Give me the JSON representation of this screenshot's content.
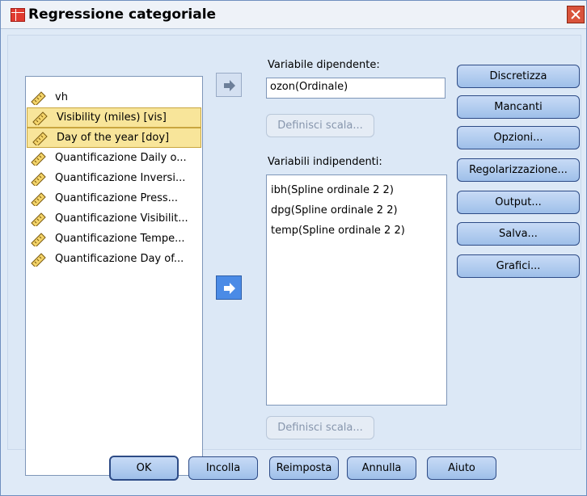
{
  "window": {
    "title": "Regressione categoriale"
  },
  "source_list": [
    {
      "label": "vh",
      "selected": false
    },
    {
      "label": "Visibility (miles) [vis]",
      "selected": true
    },
    {
      "label": "Day of the year [doy]",
      "selected": true
    },
    {
      "label": "Quantificazione Daily o...",
      "selected": false
    },
    {
      "label": "Quantificazione Inversi...",
      "selected": false
    },
    {
      "label": "Quantificazione Press...",
      "selected": false
    },
    {
      "label": "Quantificazione Visibilit...",
      "selected": false
    },
    {
      "label": "Quantificazione Tempe...",
      "selected": false
    },
    {
      "label": "Quantificazione Day of...",
      "selected": false
    }
  ],
  "dependent": {
    "label": "Variabile dipendente:",
    "value": "ozon(Ordinale)",
    "define_scale_label": "Definisci scala..."
  },
  "independent": {
    "label": "Variabili indipendenti:",
    "items": [
      "ibh(Spline ordinale 2 2)",
      "dpg(Spline ordinale 2 2)",
      "temp(Spline ordinale 2 2)"
    ],
    "define_scale_label": "Definisci scala..."
  },
  "side_buttons": [
    "Discretizza",
    "Mancanti",
    "Opzioni...",
    "Regolarizzazione...",
    "Output...",
    "Salva...",
    "Grafici..."
  ],
  "bottom_buttons": {
    "ok": "OK",
    "paste": "Incolla",
    "reset": "Reimposta",
    "cancel": "Annulla",
    "help": "Aiuto"
  },
  "colors": {
    "selection": "#f8e59a",
    "arrow_active": "#4b8be6",
    "button_gradient_top": "#c8dbf6",
    "button_gradient_bottom": "#9ebfe9"
  },
  "icons": {
    "app": "regression-table-icon",
    "variable": "ruler-scale-icon",
    "move": "arrow-right-icon",
    "close": "close-icon"
  }
}
